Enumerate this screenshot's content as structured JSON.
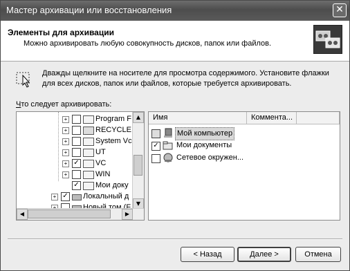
{
  "window": {
    "title": "Мастер архивации или восстановления",
    "close_label": "✕"
  },
  "header": {
    "title": "Элементы для архивации",
    "subtitle": "Можно архивировать любую совокупность дисков, папок или файлов."
  },
  "instruction": "Дважды щелкните на носителе для просмотра содержимого. Установите флажки для всех дисков, папок или файлов, которые требуется архивировать.",
  "tree": {
    "label": "Что следует архивировать:",
    "label_mnemonic": "Ч",
    "label_rest": "то следует архивировать:",
    "items": [
      {
        "label": "Program F",
        "checked": false
      },
      {
        "label": "RECYCLE",
        "checked": false
      },
      {
        "label": "System Vc",
        "checked": false
      },
      {
        "label": "UT",
        "checked": false
      },
      {
        "label": "VC",
        "checked": true
      },
      {
        "label": "WIN",
        "checked": false
      },
      {
        "label": "Мои доку",
        "checked": true
      },
      {
        "label": "Локальный д",
        "checked": true
      },
      {
        "label": "Новый том (F",
        "checked": false
      }
    ]
  },
  "list": {
    "columns": [
      "Имя",
      "Коммента..."
    ],
    "rows": [
      {
        "label": "Мой компьютер",
        "checked": false,
        "icon": "computer-icon"
      },
      {
        "label": "Мои документы",
        "checked": true,
        "icon": "documents-icon"
      },
      {
        "label": "Сетевое окружен...",
        "checked": false,
        "icon": "network-icon"
      }
    ]
  },
  "buttons": {
    "back": "< Назад",
    "next": "Далее >",
    "cancel": "Отмена"
  }
}
